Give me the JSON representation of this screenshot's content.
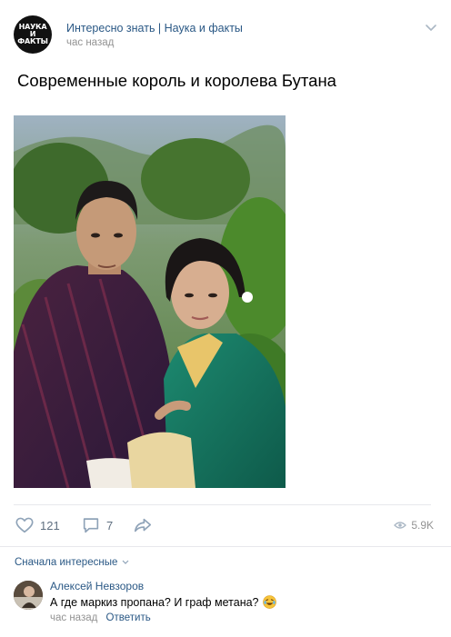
{
  "post": {
    "avatar_text": [
      "НАУКА",
      "И",
      "ФАКТЫ"
    ],
    "author": "Интересно знать | Наука и факты",
    "time": "час назад",
    "text": "Современные король и королева Бутана"
  },
  "actions": {
    "likes": "121",
    "comments": "7",
    "views": "5.9K"
  },
  "comments_section": {
    "sort_label": "Сначала интересные",
    "items": [
      {
        "author": "Алексей Невзоров",
        "text": "А где маркиз пропана? И граф метана?",
        "time": "час назад",
        "reply_label": "Ответить"
      }
    ]
  },
  "colors": {
    "link": "#2a5885",
    "secondary_text": "#939393",
    "icon": "#8fa3b8",
    "separator": "#e7e8ec"
  },
  "icons": [
    "chevron-down-icon",
    "heart-icon",
    "comment-icon",
    "share-icon",
    "eye-icon",
    "laughing-emoji-icon"
  ]
}
